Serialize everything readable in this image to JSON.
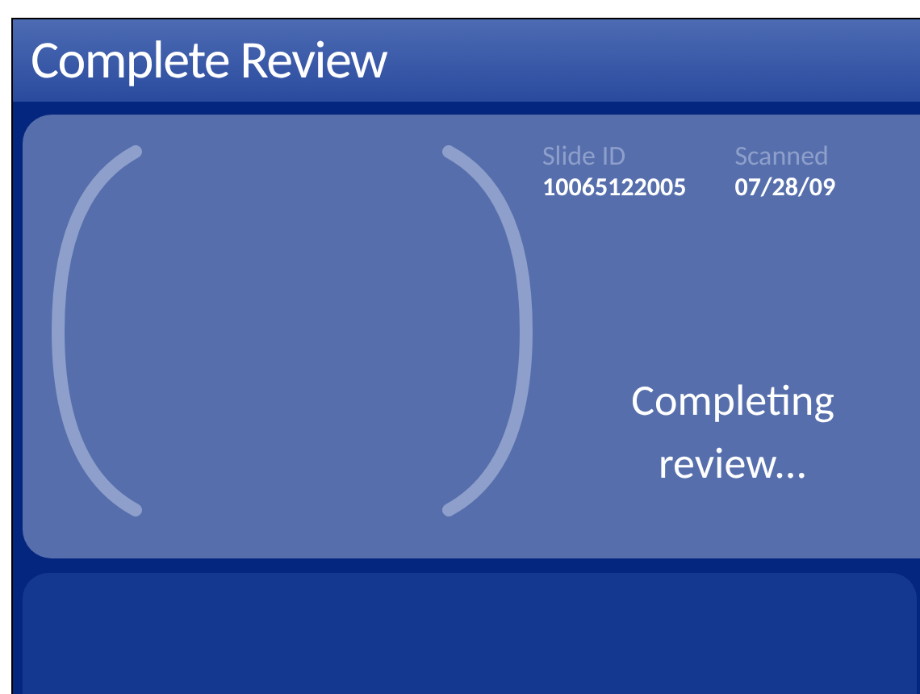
{
  "header": {
    "title": "Complete Review"
  },
  "slide": {
    "fields": [
      {
        "label": "Slide ID",
        "value": "10065122005"
      },
      {
        "label": "Scanned",
        "value": "07/28/09"
      }
    ],
    "status": "Completing review..."
  }
}
